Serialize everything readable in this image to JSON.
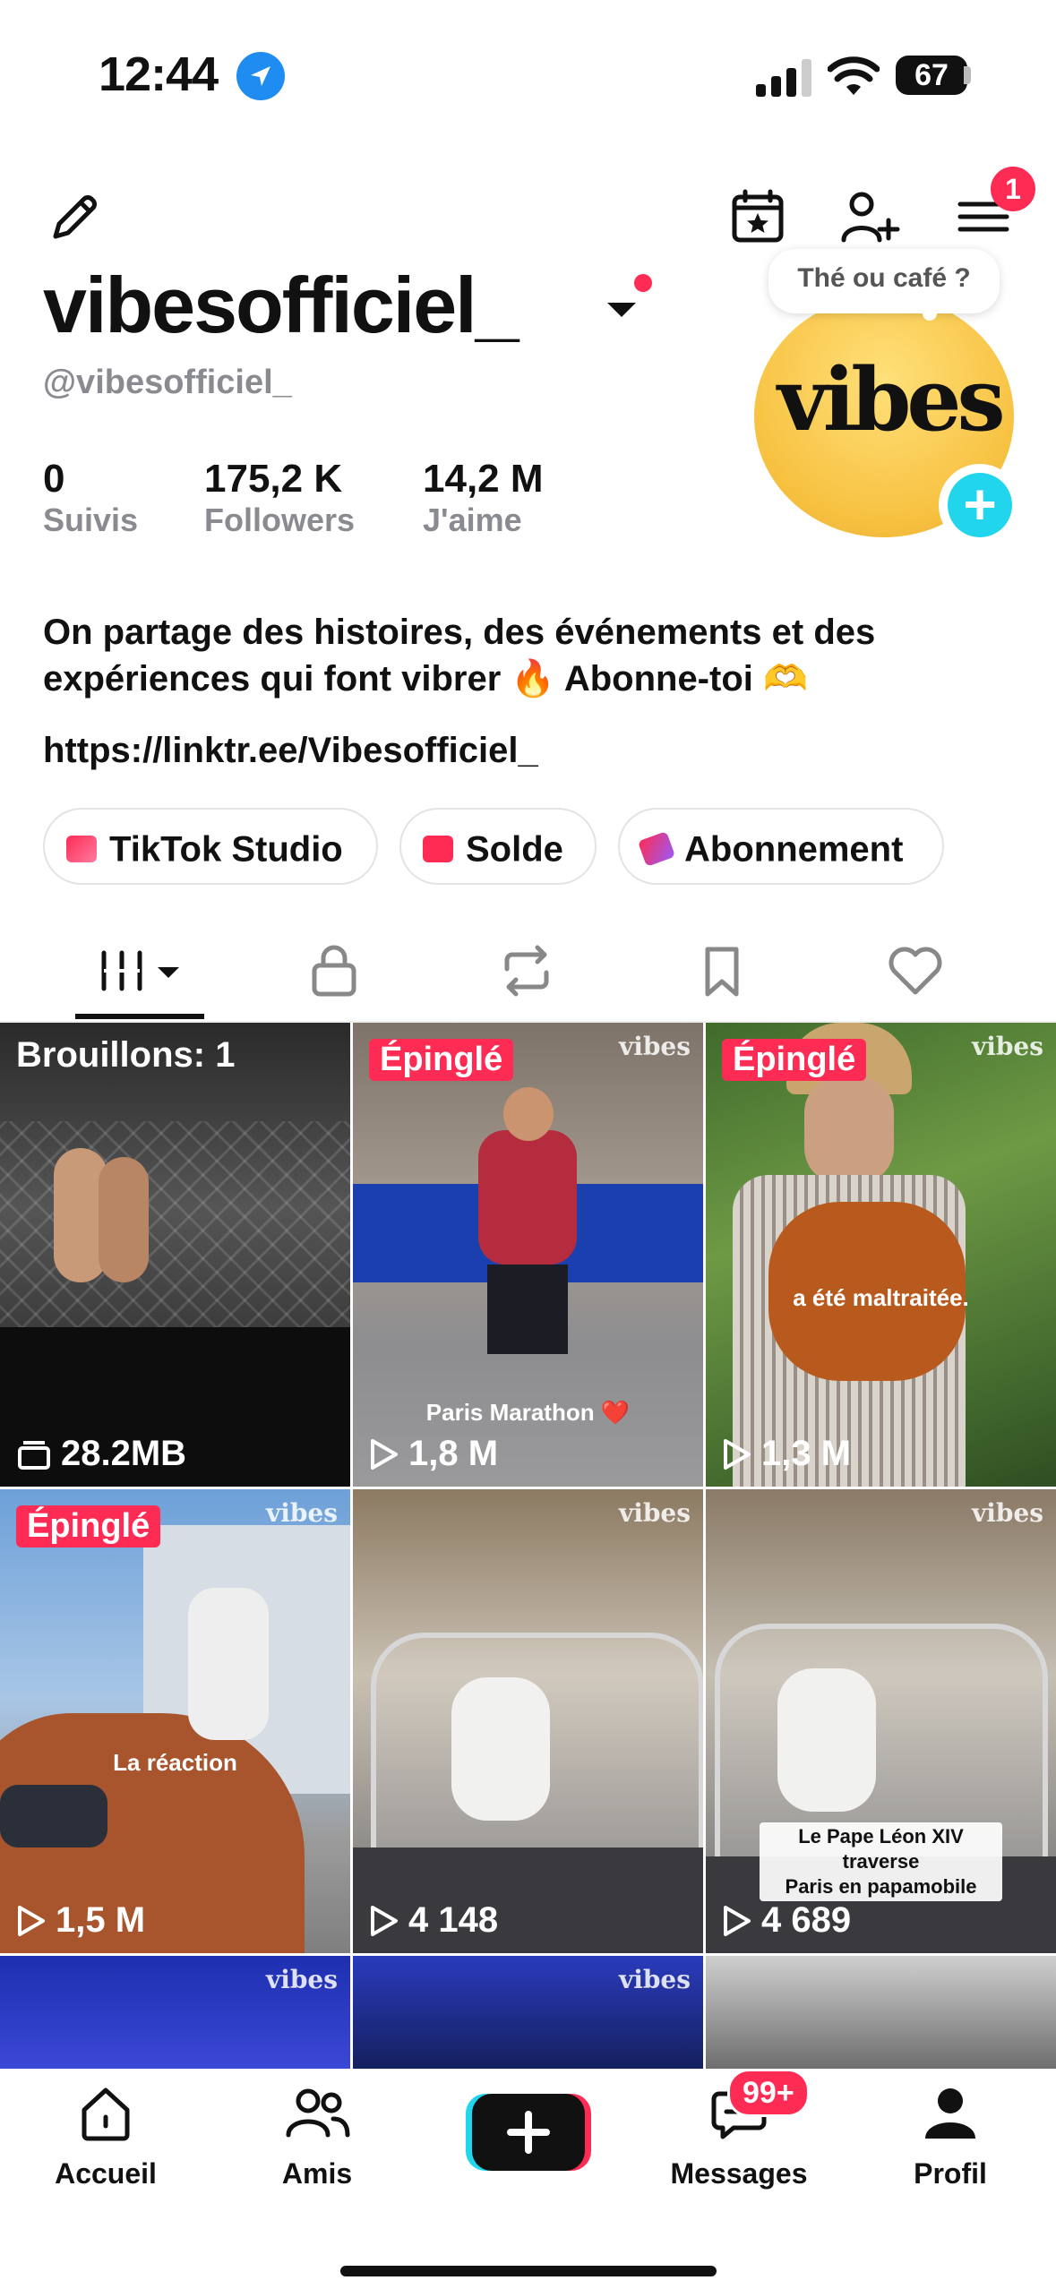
{
  "status_bar": {
    "time": "12:44",
    "battery": "67"
  },
  "header_actions": {
    "notification_count": "1"
  },
  "profile": {
    "username": "vibesofficiel_",
    "handle": "@vibesofficiel_",
    "avatar_text": "vibes",
    "avatar_bubble": "Thé ou café ?",
    "stats": [
      {
        "value": "0",
        "label": "Suivis"
      },
      {
        "value": "175,2 K",
        "label": "Followers"
      },
      {
        "value": "14,2 M",
        "label": "J'aime"
      }
    ],
    "bio_line1": "On partage des histoires, des événements et des",
    "bio_line2": "expériences qui font vibrer 🔥 Abonne-toi 🫶",
    "link": "https://linktr.ee/Vibesofficiel_"
  },
  "chips": [
    {
      "label": "TikTok Studio",
      "icon": "tiktok-studio-icon",
      "color": "#fe2c55"
    },
    {
      "label": "Solde",
      "icon": "wallet-icon",
      "color": "#fe2c55"
    },
    {
      "label": "Abonnement",
      "icon": "subscription-icon",
      "color": "#fe2c55"
    }
  ],
  "tabs": [
    "videos-grid",
    "private",
    "reposts",
    "favorites",
    "liked"
  ],
  "grid": {
    "watermark": "vibes",
    "drafts": {
      "label": "Brouillons: 1",
      "size": "28.2MB"
    },
    "items": [
      {
        "pinned": "Épinglé",
        "views": "1,8 M",
        "caption": "Paris Marathon ❤️"
      },
      {
        "pinned": "Épinglé",
        "views": "1,3 M",
        "caption": "a été maltraitée."
      },
      {
        "pinned": "Épinglé",
        "views": "1,5 M",
        "caption": "La réaction"
      },
      {
        "views": "4 148"
      },
      {
        "views": "4 689",
        "caption_line1": "Le Pape Léon XIV traverse",
        "caption_line2": "Paris en papamobile"
      }
    ]
  },
  "bottom_nav": {
    "home": "Accueil",
    "friends": "Amis",
    "messages": "Messages",
    "messages_badge": "99+",
    "profile": "Profil"
  },
  "colors": {
    "accent": "#fe2c55",
    "cyan": "#20d5ec",
    "gray_text": "#8a8b91"
  }
}
